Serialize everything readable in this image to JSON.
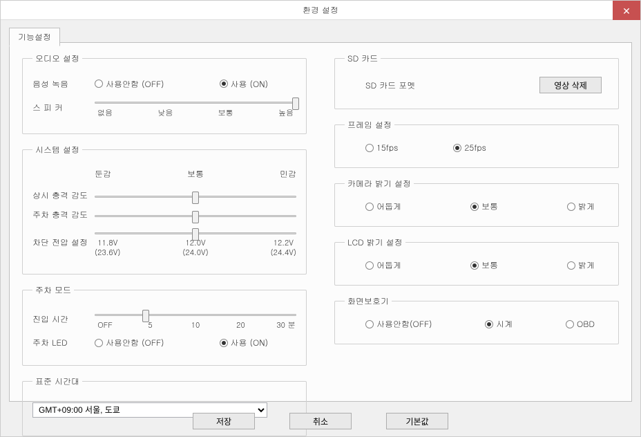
{
  "window": {
    "title": "환경 설정"
  },
  "tab": {
    "label": "기능설정"
  },
  "audio": {
    "legend": "오디오 설정",
    "voice_rec_label": "음성 녹음",
    "off_label": "사용안함 (OFF)",
    "on_label": "사용 (ON)",
    "speaker_label": "스 피 커",
    "ticks": {
      "none": "없음",
      "low": "낮음",
      "mid": "보통",
      "high": "높음"
    }
  },
  "system": {
    "legend": "시스템 설정",
    "header": {
      "dull": "둔감",
      "mid": "보통",
      "sens": "민감"
    },
    "row1": "상시 충격 감도",
    "row2": "주차 충격 감도",
    "row3": "차단 전압 설정",
    "volt_ticks": {
      "a": "11.8V\n(23.6V)",
      "b": "12.0V\n(24.0V)",
      "c": "12.2V\n(24.4V)"
    }
  },
  "parking": {
    "legend": "주차 모드",
    "entry_label": "진입 시간",
    "ticks": {
      "off": "OFF",
      "t5": "5",
      "t10": "10",
      "t20": "20",
      "t30": "30 분"
    },
    "led_label": "주차 LED",
    "off_label": "사용안함 (OFF)",
    "on_label": "사용 (ON)"
  },
  "tz": {
    "legend": "표준 시간대",
    "value": "GMT+09:00 서울, 도쿄"
  },
  "sd": {
    "legend": "SD 카드",
    "format_label": "SD 카드 포멧",
    "delete_btn": "영상 삭제"
  },
  "frame": {
    "legend": "프레임 설정",
    "fps15": "15fps",
    "fps25": "25fps"
  },
  "cam": {
    "legend": "카메라 밝기 설정",
    "dark": "어둡게",
    "mid": "보통",
    "bright": "밝게"
  },
  "lcd": {
    "legend": "LCD 밝기 설정",
    "dark": "어둡게",
    "mid": "보통",
    "bright": "밝게"
  },
  "saver": {
    "legend": "화면보호기",
    "off": "사용안함(OFF)",
    "clock": "시계",
    "obd": "OBD"
  },
  "footer": {
    "save": "저장",
    "cancel": "취소",
    "default": "기본값"
  }
}
